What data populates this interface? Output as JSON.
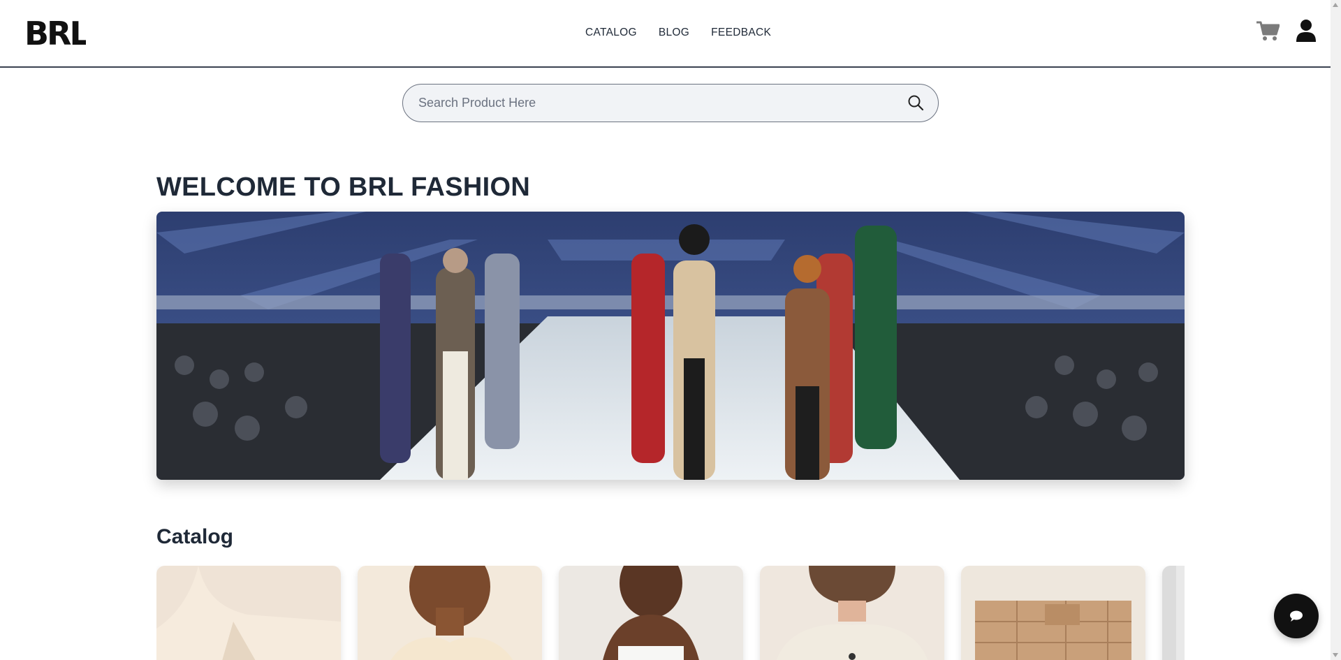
{
  "brand": {
    "logo_text": "BRL"
  },
  "nav": {
    "links": [
      {
        "label": "CATALOG"
      },
      {
        "label": "BLOG"
      },
      {
        "label": "FEEDBACK"
      }
    ],
    "cart_icon": "cart-icon",
    "user_icon": "user-icon"
  },
  "search": {
    "placeholder": "Search Product Here",
    "value": "",
    "icon": "search-icon"
  },
  "hero": {
    "title": "WELCOME TO BRL FASHION"
  },
  "catalog": {
    "title": "Catalog",
    "cards": [
      {
        "tone": "#efe3d6"
      },
      {
        "tone": "#f3e9db"
      },
      {
        "tone": "#ece8e3"
      },
      {
        "tone": "#efe7de"
      },
      {
        "tone": "#d9c3a6"
      },
      {
        "tone": "#e9e9e9"
      }
    ]
  },
  "chat": {
    "icon": "chat-bubble-icon"
  }
}
